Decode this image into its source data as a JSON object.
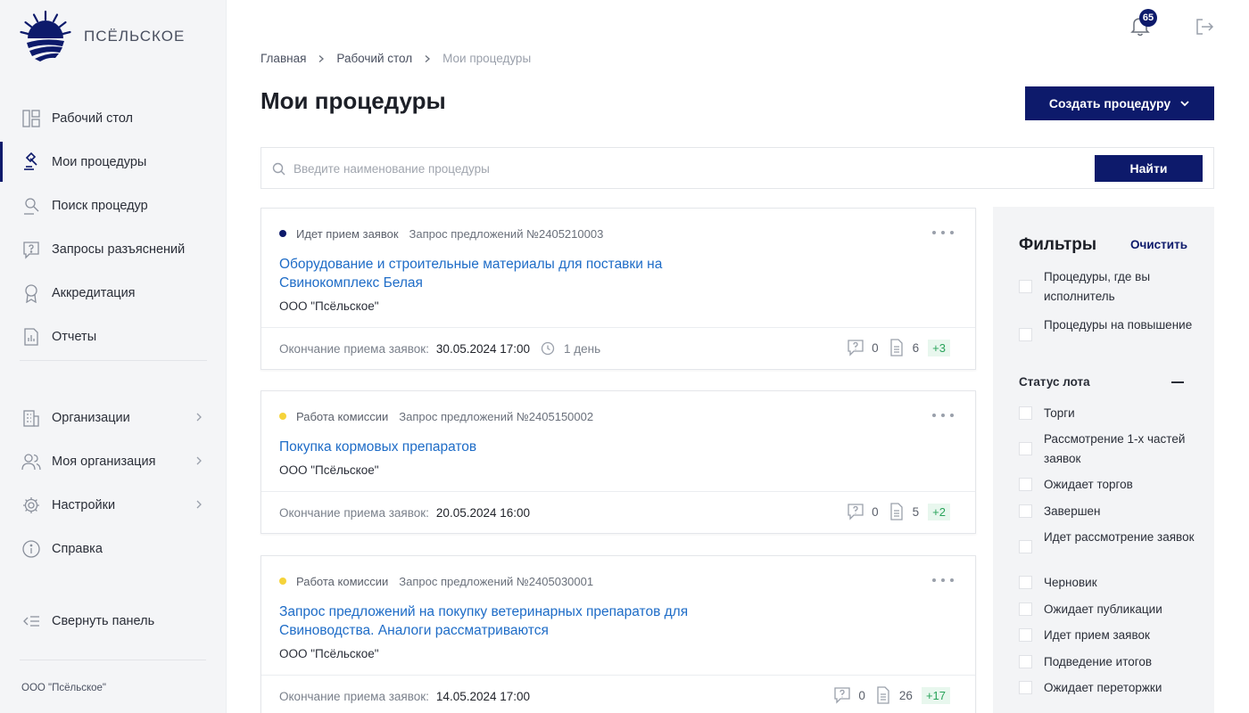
{
  "brand": {
    "name": "ПСЁЛЬСКОЕ"
  },
  "sidebar": {
    "items": [
      {
        "label": "Рабочий стол",
        "icon": "dashboard-icon"
      },
      {
        "label": "Мои процедуры",
        "icon": "gavel-icon",
        "active": true
      },
      {
        "label": "Поиск процедур",
        "icon": "person-search-icon"
      },
      {
        "label": "Запросы разъяснений",
        "icon": "question-icon"
      },
      {
        "label": "Аккредитация",
        "icon": "award-icon"
      },
      {
        "label": "Отчеты",
        "icon": "report-icon"
      }
    ],
    "group2": [
      {
        "label": "Организации",
        "icon": "building-icon"
      },
      {
        "label": "Моя организация",
        "icon": "users-icon"
      },
      {
        "label": "Настройки",
        "icon": "gear-icon"
      },
      {
        "label": "Справка",
        "icon": "info-icon"
      }
    ],
    "collapse_label": "Свернуть панель",
    "footer": "ООО \"Псёльское\""
  },
  "header": {
    "notifications_count": "65"
  },
  "breadcrumb": {
    "home": "Главная",
    "desk": "Рабочий стол",
    "current": "Мои процедуры"
  },
  "page": {
    "title": "Мои процедуры",
    "create_label": "Создать процедуру"
  },
  "search": {
    "placeholder": "Введите наименование процедуры",
    "button": "Найти"
  },
  "accent_color": "#0d1a6b",
  "procedures": [
    {
      "status": "Идет прием заявок",
      "status_color": "#0d1a6b",
      "number": "Запрос предложений №2405210003",
      "title": "Оборудование и строительные материалы для поставки на Свинокомплекс Белая",
      "org": "ООО \"Псёльское\"",
      "deadline_label": "Окончание приема заявок:",
      "deadline": "30.05.2024 17:00",
      "remaining": "1 день",
      "questions": "0",
      "docs": "6",
      "new_docs": "+3"
    },
    {
      "status": "Работа комиссии",
      "status_color": "#f5d33a",
      "number": "Запрос предложений №2405150002",
      "title": "Покупка кормовых препаратов",
      "org": "ООО \"Псёльское\"",
      "deadline_label": "Окончание приема заявок:",
      "deadline": "20.05.2024 16:00",
      "questions": "0",
      "docs": "5",
      "new_docs": "+2"
    },
    {
      "status": "Работа комиссии",
      "status_color": "#f5d33a",
      "number": "Запрос предложений №2405030001",
      "title": "Запрос предложений на покупку ветеринарных препаратов для Свиноводства. Аналоги рассматриваются",
      "org": "ООО \"Псёльское\"",
      "deadline_label": "Окончание приема заявок:",
      "deadline": "14.05.2024 17:00",
      "questions": "0",
      "docs": "26",
      "new_docs": "+17"
    }
  ],
  "filters": {
    "title": "Фильтры",
    "clear": "Очистить",
    "top_options": [
      "Процедуры, где вы исполнитель",
      "Процедуры на повышение"
    ],
    "status_title": "Статус лота",
    "statuses": [
      "Торги",
      "Рассмотрение 1-х частей заявок",
      "Ожидает торгов",
      "Завершен",
      "Идет рассмотрение заявок",
      "Черновик",
      "Ожидает публикации",
      "Идет прием заявок",
      "Подведение итогов",
      "Ожидает переторжки"
    ]
  }
}
